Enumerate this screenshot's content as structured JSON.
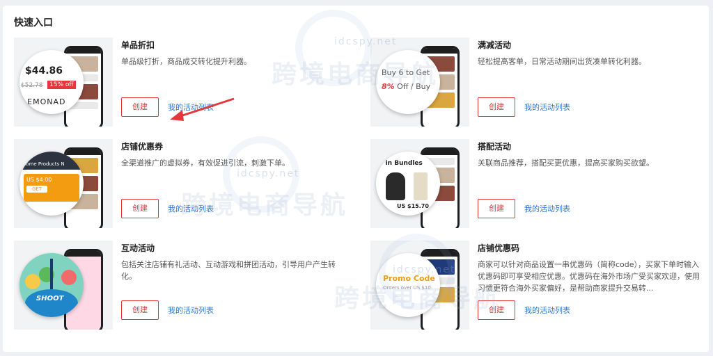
{
  "panel": {
    "title": "快速入口"
  },
  "cards": [
    {
      "title": "单品折扣",
      "desc": "单品级打折，商品成交转化提升利器。",
      "create": "创建",
      "list": "我的活动列表",
      "thumb": {
        "price": "$44.86",
        "old": "$52.78",
        "badge": "15% off",
        "brand": "LEMONAD"
      }
    },
    {
      "title": "满减活动",
      "desc": "轻松提高客单，日常活动期间出货凑单转化利器。",
      "create": "创建",
      "list": "我的活动列表",
      "thumb": {
        "line1": "Buy 6 to Get",
        "line2_em": "8%",
        "line2": " Off / Buy"
      }
    },
    {
      "title": "店铺优惠券",
      "desc": "全渠道推广的虚拟券，有效促进引流，刺激下单。",
      "create": "创建",
      "list": "我的活动列表",
      "thumb": {
        "nav": "Home  Products  N",
        "coupon": "US $4.00",
        "get": "GET"
      }
    },
    {
      "title": "搭配活动",
      "desc": "关联商品推荐，搭配买更优惠，提高买家购买欲望。",
      "create": "创建",
      "list": "我的活动列表",
      "thumb": {
        "heading": "p in Bundles",
        "price": "US $15.70"
      }
    },
    {
      "title": "互动活动",
      "desc": "包括关注店铺有礼活动、互动游戏和拼团活动，引导用户产生转化。",
      "create": "创建",
      "list": "我的活动列表",
      "thumb": {
        "label": "SHOOT"
      }
    },
    {
      "title": "店铺优惠码",
      "desc": "商家可以针对商品设置一串优惠码（简称code），买家下单时输入优惠码即可享受相应优惠。优惠码在海外市场广受买家欢迎，使用习惯更符合海外买家偏好，是帮助商家提升交易转...",
      "create": "创建",
      "list": "我的活动列表",
      "thumb": {
        "label": "Promo Code",
        "sub": "Orders over US $10"
      }
    }
  ],
  "watermark": {
    "text": "跨境电商导航",
    "domain": "idcspy.net"
  },
  "colors": {
    "accent": "#e4393c",
    "link": "#2c77d8"
  }
}
